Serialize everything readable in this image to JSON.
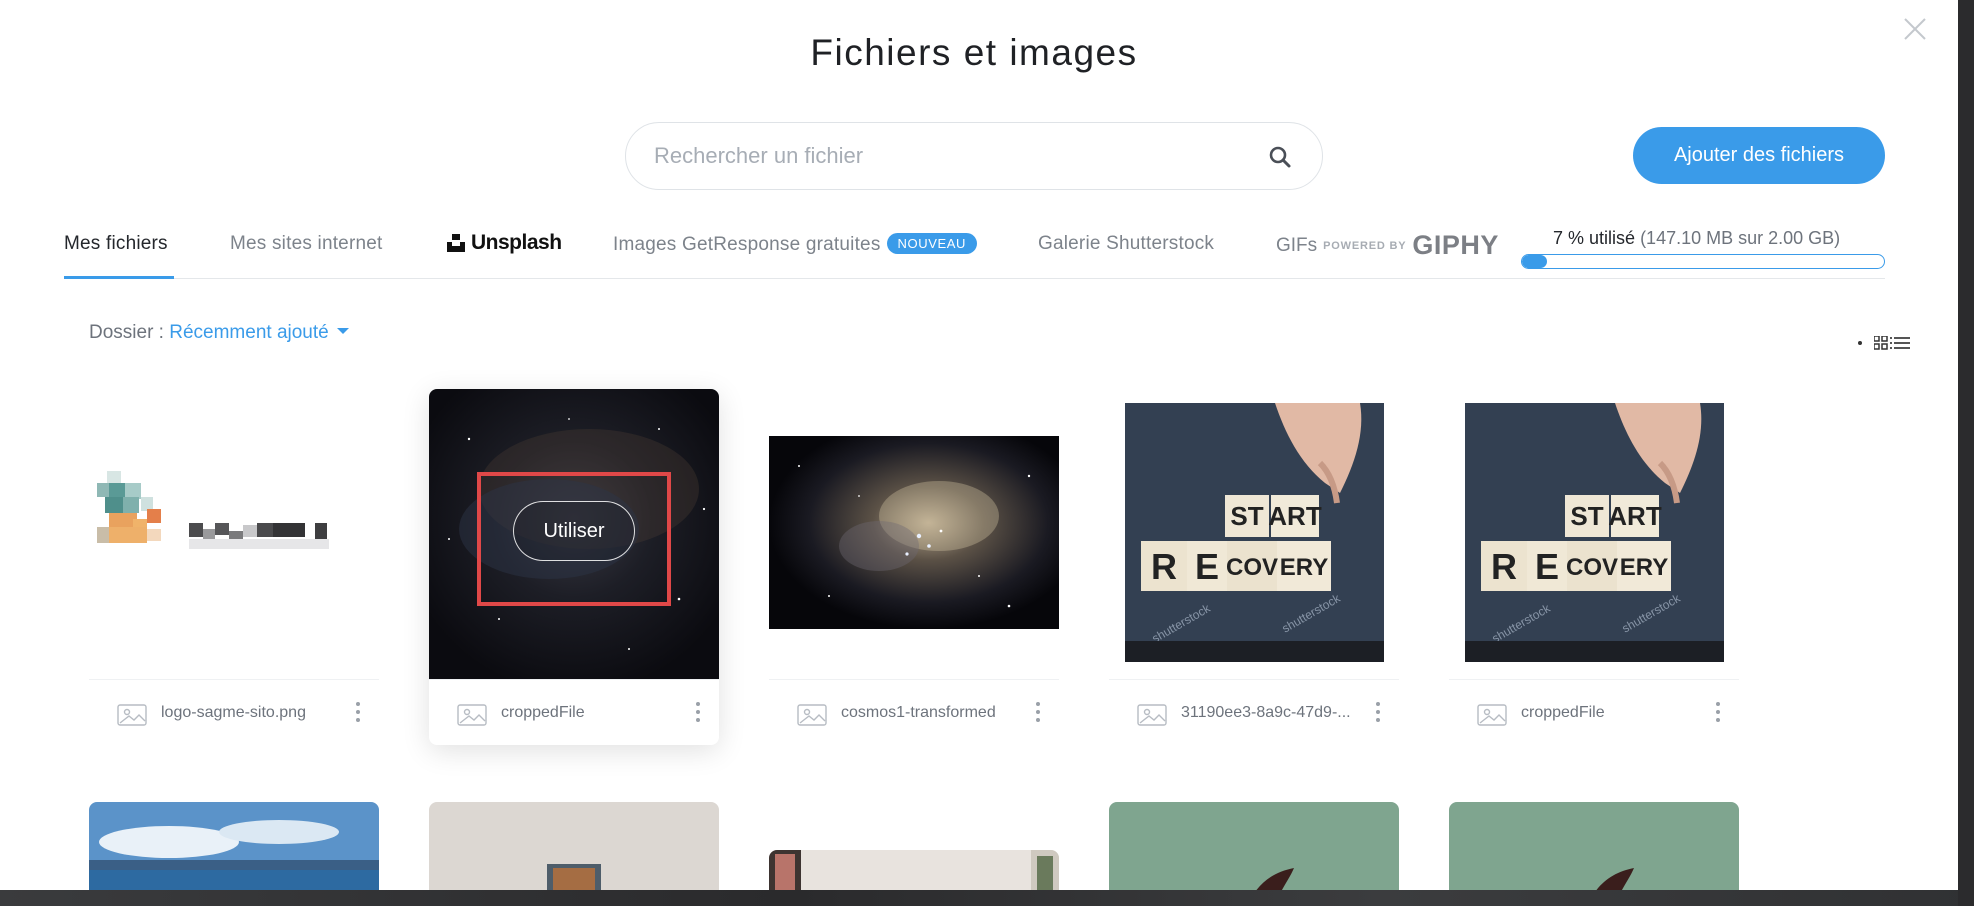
{
  "modal": {
    "title": "Fichiers et images",
    "close_icon": "close-icon"
  },
  "search": {
    "placeholder": "Rechercher un fichier",
    "value": "",
    "icon": "search-icon"
  },
  "add_button": {
    "label": "Ajouter des fichiers"
  },
  "tabs": [
    {
      "label": "Mes fichiers",
      "active": true
    },
    {
      "label": "Mes sites internet",
      "active": false
    },
    {
      "label": "Unsplash",
      "active": false
    },
    {
      "label": "Images GetResponse gratuites",
      "badge": "NOUVEAU",
      "active": false
    },
    {
      "label": "Galerie Shutterstock",
      "active": false
    },
    {
      "label": "GIFs",
      "powered": "POWERED BY",
      "logo": "GIPHY",
      "active": false
    }
  ],
  "storage": {
    "percent_text": "7 % utilisé",
    "detail_text": "(147.10 MB sur 2.00 GB)",
    "fraction": 0.07
  },
  "folder": {
    "label": "Dossier :",
    "value": "Récemment ajouté"
  },
  "view_toggle": [
    "grid-view-icon",
    "list-view-icon"
  ],
  "files": [
    {
      "name": "logo-sagme-sito.png",
      "thumb": "pixelated-logo"
    },
    {
      "name": "croppedFile",
      "thumb": "nebula-dark",
      "hover": true,
      "action": "Utiliser"
    },
    {
      "name": "cosmos1-transformed",
      "thumb": "nebula"
    },
    {
      "name": "31190ee3-8a9c-47d9-...",
      "thumb": "restart-recovery-blocks"
    },
    {
      "name": "croppedFile",
      "thumb": "restart-recovery-blocks"
    }
  ],
  "restart_blocks": {
    "top": [
      "ST",
      "ART"
    ],
    "bottom": [
      "R",
      "E",
      "COV",
      "ERY"
    ],
    "watermark": "shutterstock"
  },
  "row2_thumbs": [
    "sea-sky",
    "room-wall",
    "interior-window",
    "green-object",
    "green-object"
  ],
  "colors": {
    "accent": "#3a9be9",
    "highlight_box": "#e04848"
  }
}
